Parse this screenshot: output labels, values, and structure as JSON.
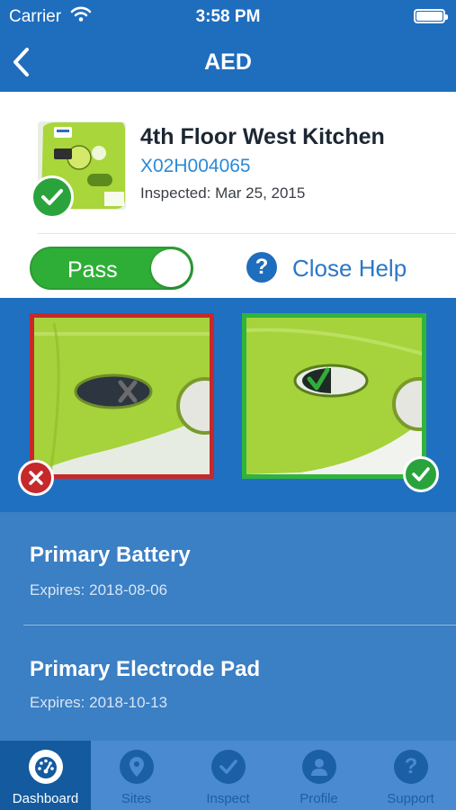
{
  "status_bar": {
    "carrier": "Carrier",
    "time": "3:58 PM"
  },
  "nav": {
    "title": "AED",
    "back_icon": "chevron-left-icon"
  },
  "device": {
    "name": "4th Floor West Kitchen",
    "serial": "X02H004065",
    "inspected": "Inspected: Mar 25, 2015",
    "status_icon": "check-icon"
  },
  "inspection": {
    "toggle_label": "Pass",
    "help_label": "Close Help",
    "help_icon": "question-icon"
  },
  "help_images": {
    "bad_icon": "x-icon",
    "good_icon": "check-icon"
  },
  "components": [
    {
      "name": "Primary Battery",
      "expires": "Expires: 2018-08-06"
    },
    {
      "name": "Primary Electrode Pad",
      "expires": "Expires: 2018-10-13"
    }
  ],
  "tabs": [
    {
      "label": "Dashboard",
      "icon": "gauge-icon",
      "active": true
    },
    {
      "label": "Sites",
      "icon": "map-pin-icon",
      "active": false
    },
    {
      "label": "Inspect",
      "icon": "check-icon",
      "active": false
    },
    {
      "label": "Profile",
      "icon": "person-icon",
      "active": false
    },
    {
      "label": "Support",
      "icon": "question-icon",
      "active": false
    }
  ],
  "colors": {
    "primary": "#1f6dbd",
    "pass_green": "#2fae37",
    "fail_red": "#c7282b",
    "serial_blue": "#2c8ad6"
  }
}
